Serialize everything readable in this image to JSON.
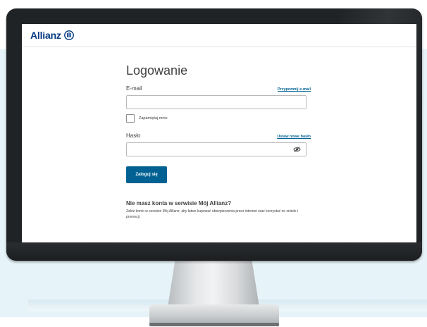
{
  "site": {
    "brand": "Allianz"
  },
  "login": {
    "title": "Logowanie",
    "email_label": "E-mail",
    "remind_email_link": "Przypomnij e-mail",
    "email_value": "",
    "remember_label": "Zapamiętaj mnie",
    "remember_checked": false,
    "password_label": "Hasło",
    "set_password_link": "Ustaw nowe hasło",
    "password_value": "",
    "password_visibility_icon": "eye-slash-icon",
    "submit_label": "Zaloguj się"
  },
  "promo": {
    "title": "Nie masz konta w serwisie Mój Allianz?",
    "text": "Załóż konto w serwisie Mój Allianz, aby łatwo kupować ubezpieczenia przez internet oraz korzystać ze zniżek i promocji."
  },
  "colors": {
    "brand_blue": "#003781",
    "button_blue": "#006192",
    "text": "#414141",
    "background_panel": "#e6f3f8"
  }
}
